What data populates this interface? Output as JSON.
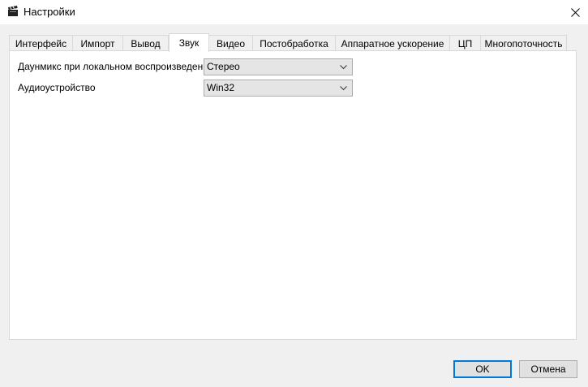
{
  "window": {
    "title": "Настройки",
    "app_icon": "clapperboard-icon",
    "close_icon": "close-icon"
  },
  "tabs": [
    {
      "label": "Интерфейс",
      "active": false
    },
    {
      "label": "Импорт",
      "active": false
    },
    {
      "label": "Вывод",
      "active": false
    },
    {
      "label": "Звук",
      "active": true
    },
    {
      "label": "Видео",
      "active": false
    },
    {
      "label": "Постобработка",
      "active": false
    },
    {
      "label": "Аппаратное ускорение",
      "active": false
    },
    {
      "label": "ЦП",
      "active": false
    },
    {
      "label": "Многопоточность",
      "active": false
    }
  ],
  "sound": {
    "downmix_label": "Даунмикс при локальном воспроизведении:",
    "downmix_value": "Стерео",
    "device_label": "Аудиоустройство",
    "device_value": "Win32"
  },
  "buttons": {
    "ok": "OK",
    "cancel": "Отмена"
  },
  "colors": {
    "accent": "#0078d7",
    "window_bg": "#f0f0f0",
    "panel_bg": "#ffffff"
  }
}
